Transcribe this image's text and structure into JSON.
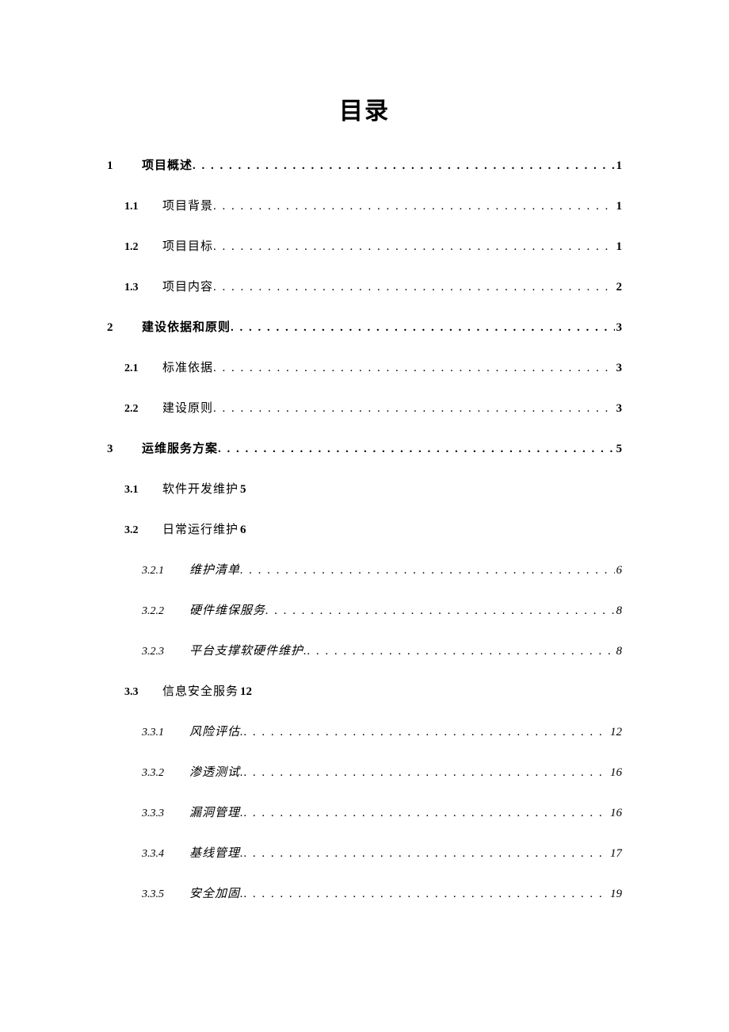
{
  "title": "目录",
  "toc": [
    {
      "level": 1,
      "num": "1",
      "label": "项目概述",
      "page": "1",
      "dots": true
    },
    {
      "level": 2,
      "num": "1.1",
      "label": "项目背景",
      "page": "1",
      "dots": true
    },
    {
      "level": 2,
      "num": "1.2",
      "label": "项目目标",
      "page": "1",
      "dots": true
    },
    {
      "level": 2,
      "num": "1.3",
      "label": "项目内容",
      "page": "2",
      "dots": true
    },
    {
      "level": 1,
      "num": "2",
      "label": "建设依据和原则",
      "page": "3",
      "dots": true
    },
    {
      "level": 2,
      "num": "2.1",
      "label": "标准依据",
      "page": "3",
      "dots": true
    },
    {
      "level": 2,
      "num": "2.2",
      "label": "建设原则",
      "page": "3",
      "dots": true
    },
    {
      "level": 1,
      "num": "3",
      "label": "运维服务方案",
      "page": "5",
      "dots": true
    },
    {
      "level": 2,
      "num": "3.1",
      "label": "软件开发维护",
      "page": "5",
      "dots": false
    },
    {
      "level": 2,
      "num": "3.2",
      "label": "日常运行维护",
      "page": "6",
      "dots": false
    },
    {
      "level": 3,
      "num": "3.2.1",
      "label": "维护清单",
      "page": "6",
      "dots": true
    },
    {
      "level": 3,
      "num": "3.2.2",
      "label": "硬件维保服务",
      "page": "8",
      "dots": true
    },
    {
      "level": 3,
      "num": "3.2.3",
      "label": "平台支撑软硬件维护.",
      "page": "8",
      "dots": true
    },
    {
      "level": 2,
      "num": "3.3",
      "label": "信息安全服务",
      "page": "12",
      "dots": false
    },
    {
      "level": 3,
      "num": "3.3.1",
      "label": "风险评估.",
      "page": "12",
      "dots": true
    },
    {
      "level": 3,
      "num": "3.3.2",
      "label": "渗透测试.",
      "page": "16",
      "dots": true
    },
    {
      "level": 3,
      "num": "3.3.3",
      "label": "漏洞管理.",
      "page": "16",
      "dots": true
    },
    {
      "level": 3,
      "num": "3.3.4",
      "label": "基线管理.",
      "page": "17",
      "dots": true
    },
    {
      "level": 3,
      "num": "3.3.5",
      "label": "安全加固.",
      "page": "19",
      "dots": true
    }
  ]
}
